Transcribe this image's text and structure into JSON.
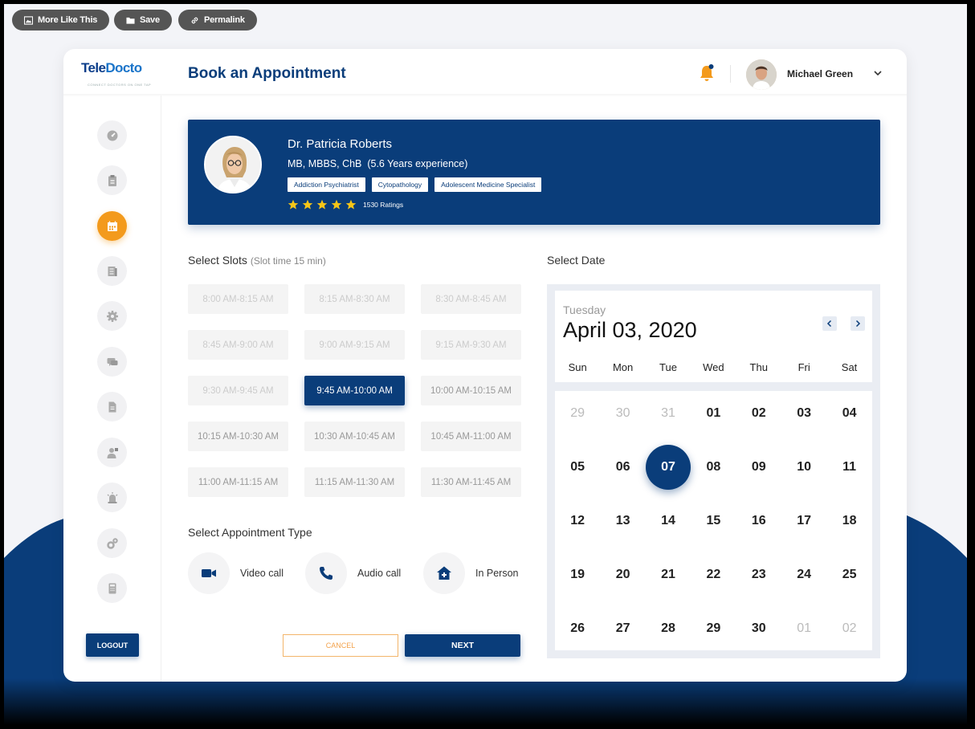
{
  "toolbar": {
    "more_like_this": "More Like This",
    "save": "Save",
    "permalink": "Permalink"
  },
  "brand": {
    "logo_prefix": "Tele",
    "logo_suffix": "Docto",
    "logo_tagline": "CONNECT DOCTORS ON ONE TAP"
  },
  "header": {
    "title": "Book an Appointment",
    "user_name": "Michael Green"
  },
  "sidebar": {
    "icons": [
      "dashboard-icon",
      "clipboard-icon",
      "calendar-icon",
      "document-icon",
      "settings-icon",
      "chat-icon",
      "file-icon",
      "doctor-icon",
      "alarm-icon",
      "gears-icon",
      "calculator-icon"
    ],
    "active_index": 2,
    "logout": "LOGOUT"
  },
  "doctor": {
    "name": "Dr. Patricia Roberts",
    "qualification": "MB, MBBS, ChB",
    "experience": "(5.6 Years experience)",
    "tags": [
      "Addiction Psychiatrist",
      "Cytopathology",
      "Adolescent Medicine Specialist"
    ],
    "rating_stars": 5,
    "ratings": "1530 Ratings"
  },
  "slots": {
    "title": "Select Slots",
    "subtitle": "(Slot time 15 min)",
    "items": [
      {
        "label": "8:00 AM-8:15 AM",
        "state": "disabled"
      },
      {
        "label": "8:15 AM-8:30 AM",
        "state": "disabled"
      },
      {
        "label": "8:30 AM-8:45 AM",
        "state": "disabled"
      },
      {
        "label": "8:45 AM-9:00 AM",
        "state": "disabled"
      },
      {
        "label": "9:00 AM-9:15 AM",
        "state": "disabled"
      },
      {
        "label": "9:15 AM-9:30 AM",
        "state": "disabled"
      },
      {
        "label": "9:30 AM-9:45 AM",
        "state": "disabled"
      },
      {
        "label": "9:45 AM-10:00 AM",
        "state": "selected"
      },
      {
        "label": "10:00 AM-10:15 AM",
        "state": "available"
      },
      {
        "label": "10:15 AM-10:30 AM",
        "state": "available"
      },
      {
        "label": "10:30 AM-10:45 AM",
        "state": "available"
      },
      {
        "label": "10:45 AM-11:00 AM",
        "state": "available"
      },
      {
        "label": "11:00 AM-11:15 AM",
        "state": "available"
      },
      {
        "label": "11:15 AM-11:30 AM",
        "state": "available"
      },
      {
        "label": "11:30 AM-11:45 AM",
        "state": "available"
      }
    ]
  },
  "appointment_type": {
    "title": "Select Appointment Type",
    "options": [
      {
        "label": "Video call",
        "icon": "video-icon"
      },
      {
        "label": "Audio call",
        "icon": "phone-icon"
      },
      {
        "label": "In Person",
        "icon": "clinic-icon"
      }
    ]
  },
  "buttons": {
    "cancel": "CANCEL",
    "next": "NEXT"
  },
  "calendar": {
    "title": "Select Date",
    "weekday": "Tuesday",
    "date_label": "April 03, 2020",
    "weekdays": [
      "Sun",
      "Mon",
      "Tue",
      "Wed",
      "Thu",
      "Fri",
      "Sat"
    ],
    "weeks": [
      [
        "29",
        "30",
        "31",
        "01",
        "02",
        "03",
        "04"
      ],
      [
        "05",
        "06",
        "07",
        "08",
        "09",
        "10",
        "11"
      ],
      [
        "12",
        "13",
        "14",
        "15",
        "16",
        "17",
        "18"
      ],
      [
        "19",
        "20",
        "21",
        "22",
        "23",
        "24",
        "25"
      ],
      [
        "26",
        "27",
        "28",
        "29",
        "30",
        "01",
        "02"
      ]
    ],
    "muted": [
      [
        0,
        0
      ],
      [
        0,
        1
      ],
      [
        0,
        2
      ],
      [
        4,
        5
      ],
      [
        4,
        6
      ]
    ],
    "selected": [
      1,
      2
    ]
  },
  "colors": {
    "primary": "#0a3d7a",
    "accent": "#f39a1c",
    "star": "#f5c518"
  }
}
